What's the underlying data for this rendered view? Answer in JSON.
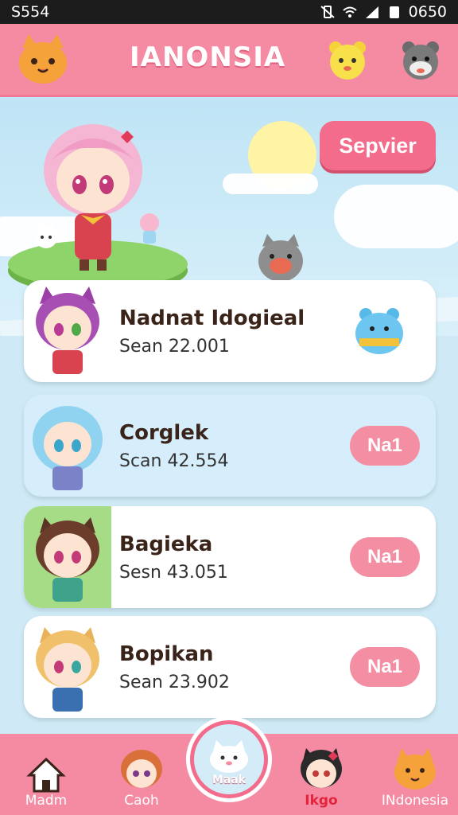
{
  "status": {
    "left": "S554",
    "right": "0650"
  },
  "header": {
    "title": "IANONSIA"
  },
  "hero": {
    "button": "Sepvier"
  },
  "list": [
    {
      "name": "Nadnat Idogieal",
      "score": "Sean 22.001"
    },
    {
      "name": "Corglek",
      "score": "Scan 42.554",
      "badge": "Na1"
    },
    {
      "name": "Bagieka",
      "score": "Sesn 43.051",
      "badge": "Na1"
    },
    {
      "name": "Bopikan",
      "score": "Sean 23.902",
      "badge": "Na1"
    }
  ],
  "nav": {
    "items": [
      {
        "label": "Madm",
        "icon": "home-icon"
      },
      {
        "label": "Caoh",
        "icon": "character-avatar-icon"
      },
      {
        "label": "Maak",
        "icon": "cat-icon"
      },
      {
        "label": "Ikgo",
        "icon": "character-avatar-icon"
      },
      {
        "label": "INdonesia",
        "icon": "cat-face-icon"
      }
    ]
  },
  "colors": {
    "accent": "#f58aa3",
    "button": "#f36c8b",
    "badge": "#f38ea3",
    "active": "#e3243b"
  }
}
